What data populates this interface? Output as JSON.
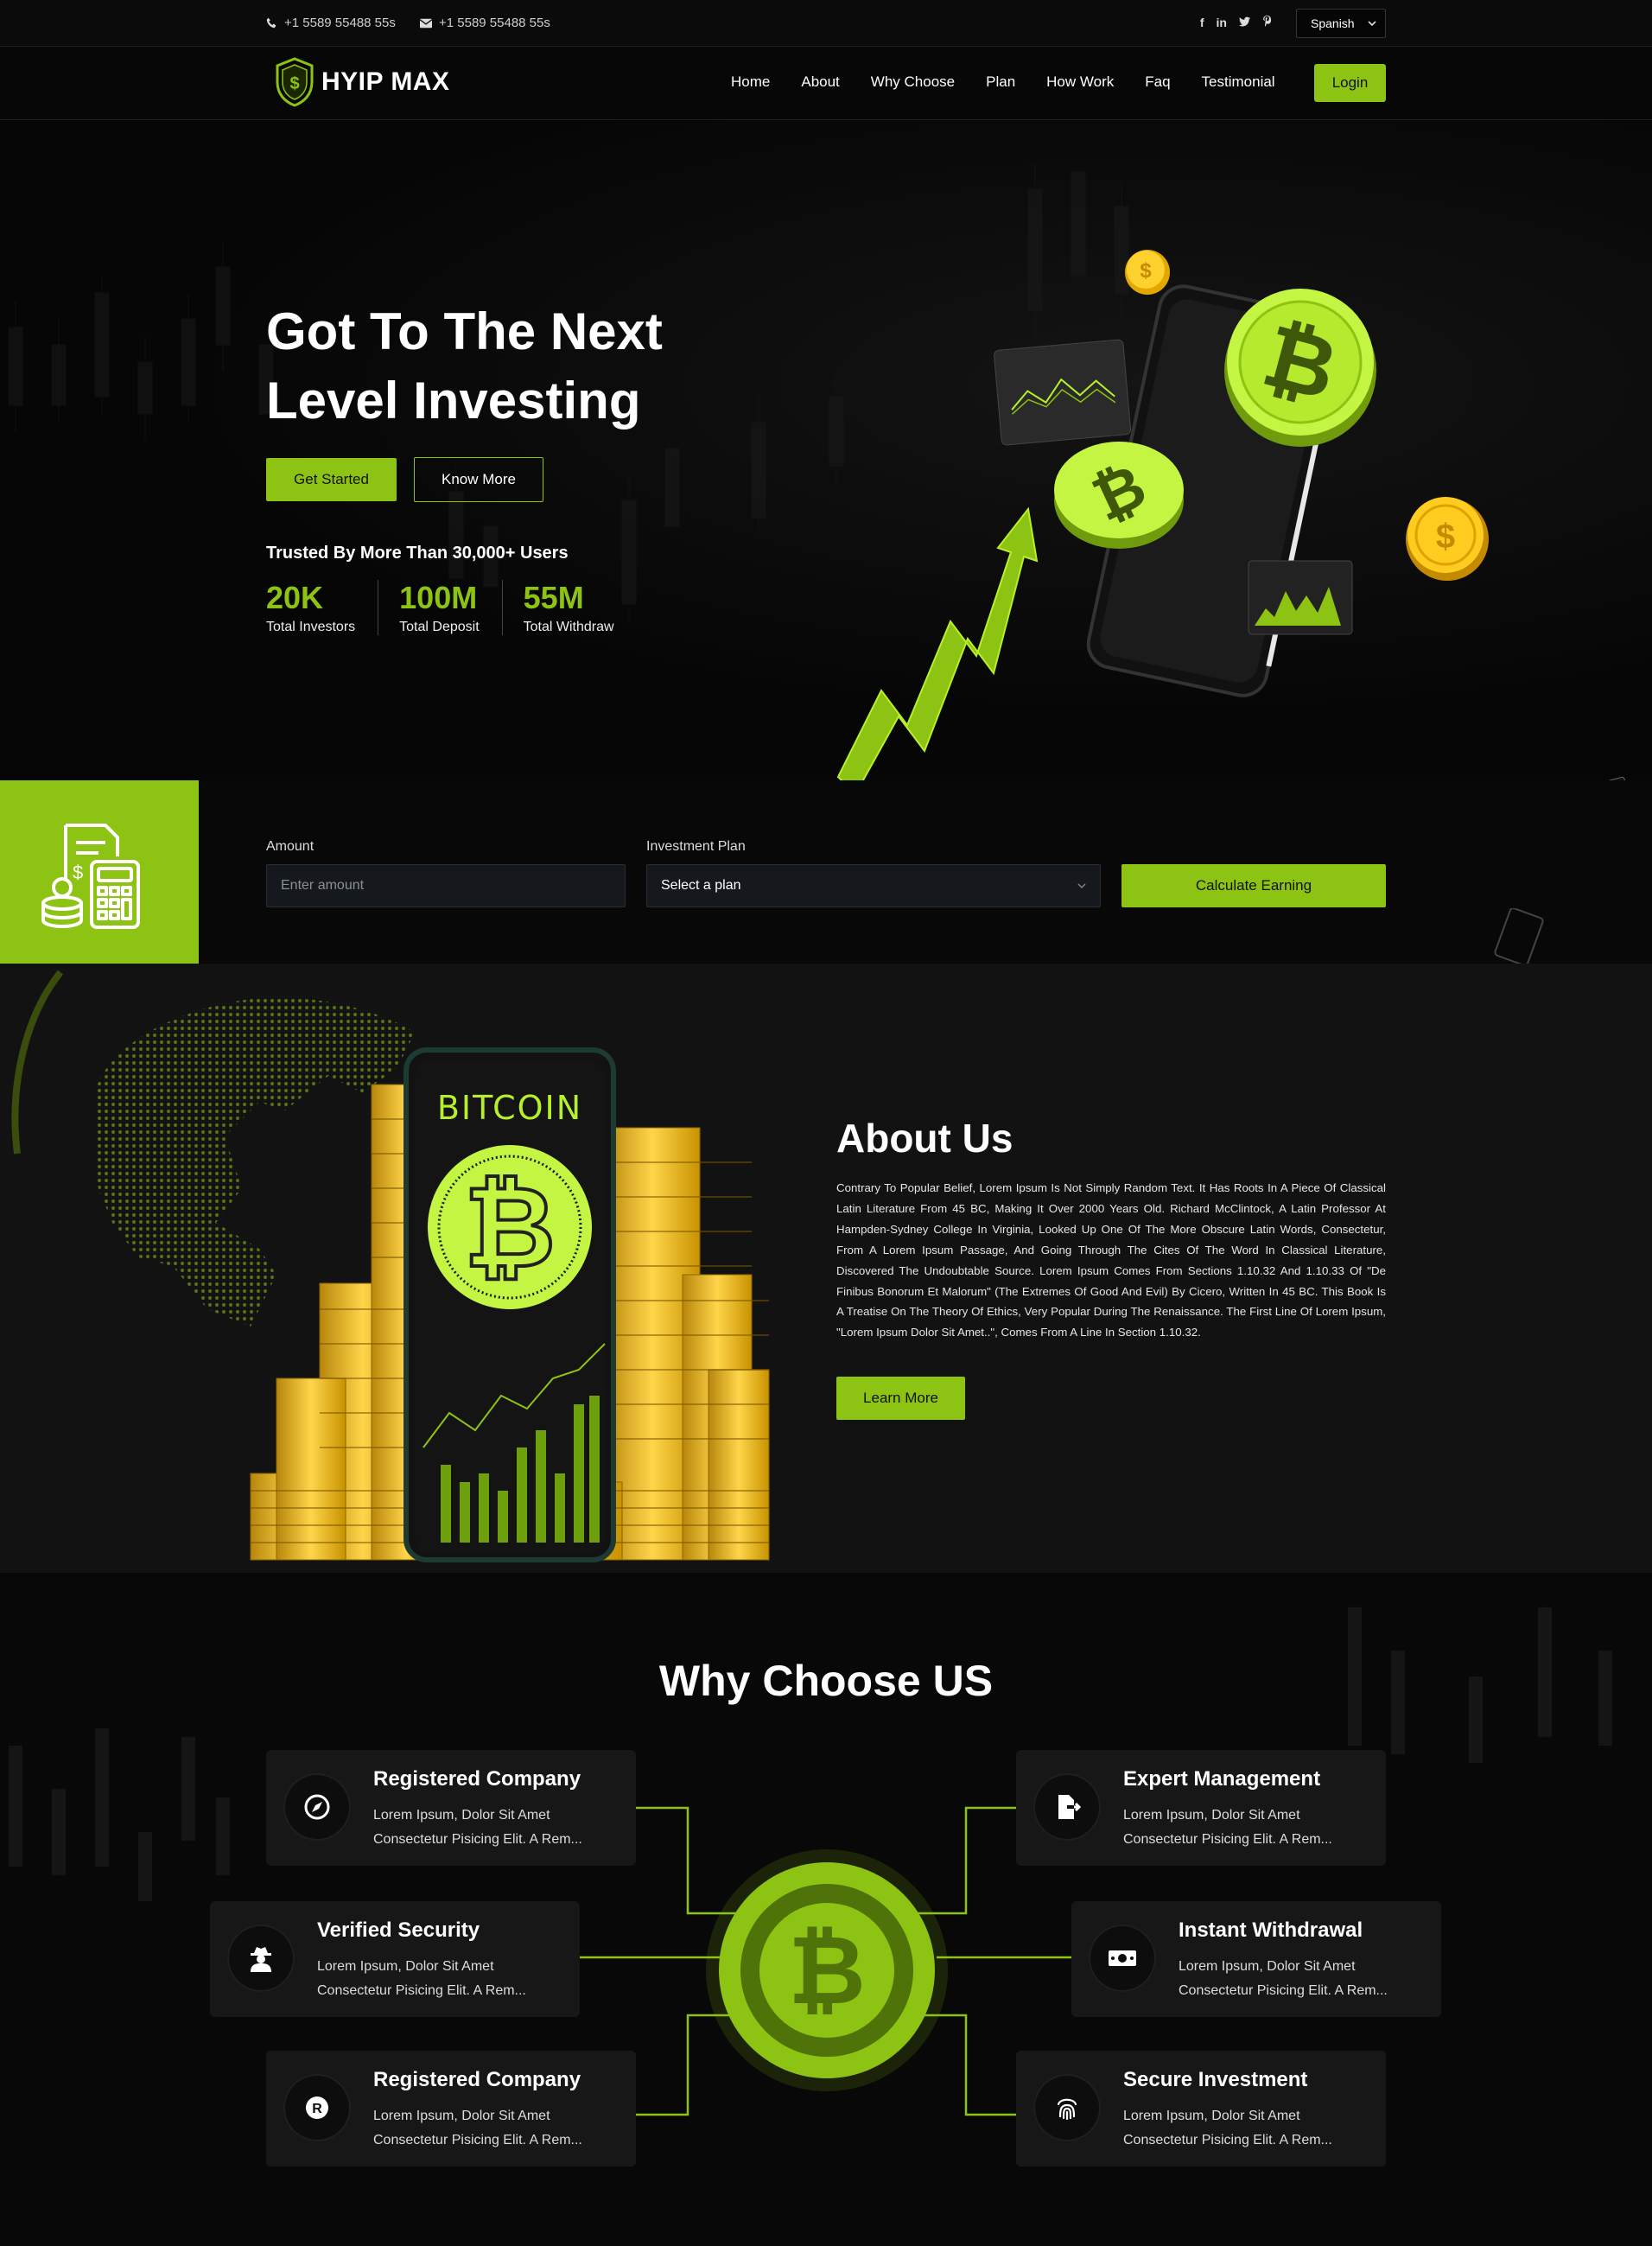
{
  "topbar": {
    "phone_1": "+1 5589 55488 55s",
    "phone_2": "+1 5589 55488 55s",
    "socials": [
      "facebook-icon",
      "linkedin-icon",
      "twitter-icon",
      "pinterest-icon"
    ],
    "language": "Spanish"
  },
  "nav": {
    "brand": "HYIP MAX",
    "items": [
      "Home",
      "About",
      "Why Choose",
      "Plan",
      "How Work",
      "Faq",
      "Testimonial"
    ],
    "login": "Login"
  },
  "hero": {
    "title_line1": "Got To The Next",
    "title_line2": "Level Investing",
    "cta_primary": "Get Started",
    "cta_secondary": "Know More",
    "trusted": "Trusted By More Than 30,000+ Users",
    "stats": [
      {
        "value": "20K",
        "label": "Total Investors"
      },
      {
        "value": "100M",
        "label": "Total Deposit"
      },
      {
        "value": "55M",
        "label": "Total Withdraw"
      }
    ]
  },
  "calculator": {
    "amount_label": "Amount",
    "amount_placeholder": "Enter amount",
    "plan_label": "Investment Plan",
    "plan_selected": "Select a plan",
    "button": "Calculate Earning"
  },
  "about": {
    "title": "About Us",
    "phone_text": "BITCOIN",
    "body": "Contrary To Popular Belief, Lorem Ipsum Is Not Simply Random Text. It Has Roots In A Piece Of Classical Latin Literature From 45 BC, Making It Over 2000 Years Old. Richard McClintock, A Latin Professor At Hampden-Sydney College In Virginia, Looked Up One Of The More Obscure Latin Words, Consectetur, From A Lorem Ipsum Passage, And Going Through The Cites Of The Word In Classical Literature, Discovered The Undoubtable Source. Lorem Ipsum Comes From Sections 1.10.32 And 1.10.33 Of \"De Finibus Bonorum Et Malorum\" (The Extremes Of Good And Evil) By Cicero, Written In 45 BC. This Book Is A Treatise On The Theory Of Ethics, Very Popular During The Renaissance. The First Line Of Lorem Ipsum, \"Lorem Ipsum Dolor Sit Amet..\", Comes From A Line In Section 1.10.32.",
    "button": "Learn More"
  },
  "why": {
    "title": "Why Choose US",
    "cards": [
      {
        "title": "Registered Company",
        "line1": "Lorem Ipsum, Dolor Sit Amet",
        "line2": "Consectetur Pisicing Elit. A Rem...",
        "icon": "compass-icon"
      },
      {
        "title": "Expert Management",
        "line1": "Lorem Ipsum, Dolor Sit Amet",
        "line2": "Consectetur Pisicing Elit. A Rem...",
        "icon": "file-export-icon"
      },
      {
        "title": "Verified Security",
        "line1": "Lorem Ipsum, Dolor Sit Amet",
        "line2": "Consectetur Pisicing Elit. A Rem...",
        "icon": "user-secret-icon"
      },
      {
        "title": "Instant Withdrawal",
        "line1": "Lorem Ipsum, Dolor Sit Amet",
        "line2": "Consectetur Pisicing Elit. A Rem...",
        "icon": "money-bill-icon"
      },
      {
        "title": "Registered Company",
        "line1": "Lorem Ipsum, Dolor Sit Amet",
        "line2": "Consectetur Pisicing Elit. A Rem...",
        "icon": "registered-icon"
      },
      {
        "title": "Secure Investment",
        "line1": "Lorem Ipsum, Dolor Sit Amet",
        "line2": "Consectetur Pisicing Elit. A Rem...",
        "icon": "fingerprint-icon"
      }
    ]
  },
  "colors": {
    "accent": "#8dc312",
    "bg": "#070707",
    "card": "#171717"
  }
}
